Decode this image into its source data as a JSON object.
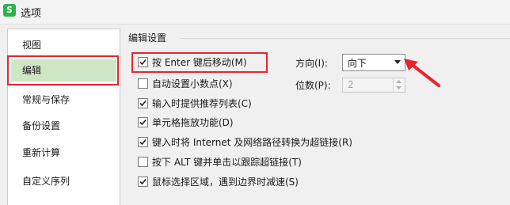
{
  "window": {
    "title": "选项",
    "app_icon_glyph": "S"
  },
  "nav": {
    "items": [
      {
        "label": "视图",
        "selected": false
      },
      {
        "label": "编辑",
        "selected": true
      },
      {
        "label": "常规与保存",
        "selected": false
      },
      {
        "label": "备份设置",
        "selected": false
      },
      {
        "label": "重新计算",
        "selected": false
      },
      {
        "label": "自定义序列",
        "selected": false
      }
    ]
  },
  "edit": {
    "group_title": "编辑设置",
    "options": [
      {
        "label": "按 Enter 键后移动(M)",
        "checked": true
      },
      {
        "label": "自动设置小数点(X)",
        "checked": false
      },
      {
        "label": "输入时提供推荐列表(C)",
        "checked": true
      },
      {
        "label": "单元格拖放功能(D)",
        "checked": true
      },
      {
        "label": "键入时将 Internet 及网络路径转换为超链接(R)",
        "checked": true
      },
      {
        "label": "按下 ALT 键并单击以跟踪超链接(T)",
        "checked": false
      },
      {
        "label": "鼠标选择区域，遇到边界时减速(S)",
        "checked": true
      }
    ],
    "direction": {
      "label": "方向(I):",
      "value": "向下"
    },
    "decimal_places": {
      "label": "位数(P):",
      "value": "2"
    }
  },
  "colors": {
    "annotation_red": "#e8242b",
    "nav_selected": "#cfe6c5",
    "app_green": "#2db14a"
  }
}
